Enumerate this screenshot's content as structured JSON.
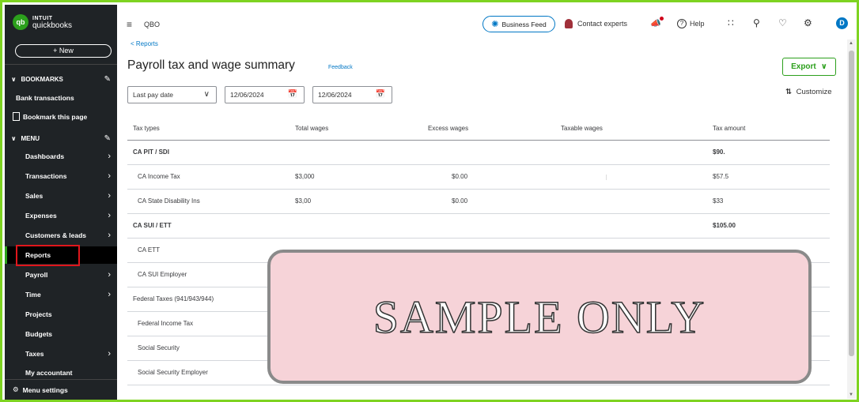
{
  "sidebar": {
    "logo_line1": "INTUIT",
    "logo_line2": "quickbooks",
    "logo_badge": "qb",
    "new_label": "+ New",
    "bookmarks_label": "BOOKMARKS",
    "bank_transactions": "Bank transactions",
    "bookmark_page": "Bookmark this page",
    "menu_label": "MENU",
    "items": [
      {
        "label": "Dashboards",
        "arrow": true
      },
      {
        "label": "Transactions",
        "arrow": true
      },
      {
        "label": "Sales",
        "arrow": true
      },
      {
        "label": "Expenses",
        "arrow": true
      },
      {
        "label": "Customers & leads",
        "arrow": true
      },
      {
        "label": "Reports",
        "arrow": false,
        "active": true
      },
      {
        "label": "Payroll",
        "arrow": true
      },
      {
        "label": "Time",
        "arrow": true
      },
      {
        "label": "Projects",
        "arrow": false
      },
      {
        "label": "Budgets",
        "arrow": false
      },
      {
        "label": "Taxes",
        "arrow": true
      },
      {
        "label": "My accountant",
        "arrow": false
      }
    ],
    "menu_settings": "Menu settings"
  },
  "topbar": {
    "company": "QBO",
    "business_feed": "Business Feed",
    "contact_experts": "Contact experts",
    "help": "Help",
    "avatar": "D"
  },
  "breadcrumb": "< Reports",
  "title": "Payroll tax and wage summary",
  "feedback": "Feedback",
  "export_label": "Export",
  "customize_label": "Customize",
  "filters": {
    "period": "Last pay date",
    "start_date": "12/06/2024",
    "end_date": "12/06/2024"
  },
  "table": {
    "headers": {
      "type": "Tax types",
      "total": "Total wages",
      "excess": "Excess wages",
      "taxable": "Taxable wages",
      "amount": "Tax amount"
    },
    "rows": [
      {
        "kind": "group",
        "type": "CA PIT / SDI",
        "total": "",
        "excess": "",
        "taxable": "",
        "amount": "$90."
      },
      {
        "kind": "sub",
        "type": "CA Income Tax",
        "total": "$3,000",
        "excess": "$0.00",
        "taxable": "",
        "amount": "$57.5"
      },
      {
        "kind": "sub",
        "type": "CA State Disability Ins",
        "total": "$3,00",
        "excess": "$0.00",
        "taxable": "",
        "amount": "$33"
      },
      {
        "kind": "group",
        "type": "CA SUI / ETT",
        "total": "",
        "excess": "",
        "taxable": "",
        "amount": "$105.00"
      },
      {
        "kind": "sub",
        "type": "CA ETT",
        "total": "",
        "excess": "",
        "taxable": "",
        "amount": ""
      },
      {
        "kind": "sub",
        "type": "CA SUI Employer",
        "total": "",
        "excess": "",
        "taxable": "",
        "amount": ""
      },
      {
        "kind": "group-light",
        "type": "Federal Taxes (941/943/944)",
        "total": "",
        "excess": "",
        "taxable": "",
        "amount": ""
      },
      {
        "kind": "sub",
        "type": "Federal Income Tax",
        "total": "",
        "excess": "",
        "taxable": "",
        "amount": ""
      },
      {
        "kind": "sub",
        "type": "Social Security",
        "total": "",
        "excess": "",
        "taxable": "",
        "amount": ""
      },
      {
        "kind": "sub",
        "type": "Social Security Employer",
        "total": "",
        "excess": "",
        "taxable": "",
        "amount": ""
      }
    ]
  },
  "watermark": "SAMPLE ONLY",
  "colors": {
    "brand_green": "#2ca01c",
    "link_blue": "#0077c5",
    "sidebar_bg": "#1f2326",
    "highlight_red": "#e0161c",
    "frame_green": "#7ed321"
  }
}
